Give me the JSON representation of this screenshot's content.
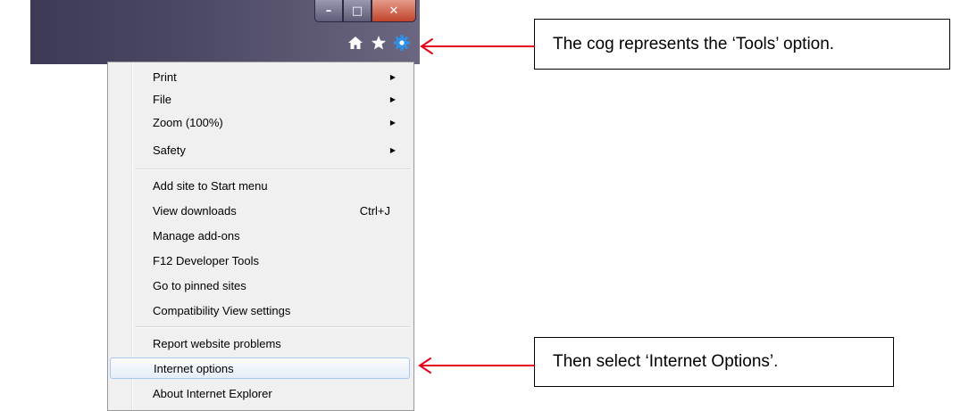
{
  "window": {
    "minimize_icon": "minimize-icon",
    "restore_icon": "restore-icon",
    "close_icon": "close-icon"
  },
  "toolbar": {
    "icons": [
      "home-icon",
      "favorites-star-icon",
      "tools-cog-icon"
    ]
  },
  "menu": {
    "items": [
      {
        "label": "Print",
        "submenu": true
      },
      {
        "label": "File",
        "submenu": true
      },
      {
        "label": "Zoom (100%)",
        "submenu": true
      },
      {
        "label": "Safety",
        "submenu": true
      },
      {
        "label": "Add site to Start menu"
      },
      {
        "label": "View downloads",
        "shortcut": "Ctrl+J"
      },
      {
        "label": "Manage add-ons"
      },
      {
        "label": "F12 Developer Tools"
      },
      {
        "label": "Go to pinned sites"
      },
      {
        "label": "Compatibility View settings"
      },
      {
        "label": "Report website problems"
      },
      {
        "label": "Internet options",
        "selected": true
      },
      {
        "label": "About Internet Explorer"
      }
    ]
  },
  "callouts": {
    "cog": "The cog represents the ‘Tools’ option.",
    "options": "Then select ‘Internet Options’."
  },
  "colors": {
    "arrow": "#e3001b",
    "cog": "#2f8fe0"
  }
}
